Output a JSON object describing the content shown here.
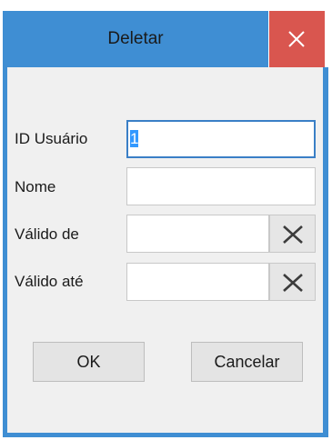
{
  "dialog": {
    "title": "Deletar",
    "close_icon": "close-icon"
  },
  "form": {
    "user_id": {
      "label": "ID Usuário",
      "value": "1"
    },
    "name": {
      "label": "Nome",
      "value": ""
    },
    "valid_from": {
      "label": "Válido de",
      "value": "",
      "clear_icon": "clear-x-icon"
    },
    "valid_until": {
      "label": "Válido até",
      "value": "",
      "clear_icon": "clear-x-icon"
    }
  },
  "buttons": {
    "ok_label": "OK",
    "cancel_label": "Cancelar"
  },
  "colors": {
    "titlebar": "#3f8ed3",
    "close_button": "#d9564f",
    "client_background": "#f0f0f0",
    "focus_border": "#3a7fc6",
    "selection": "#3399ff"
  }
}
